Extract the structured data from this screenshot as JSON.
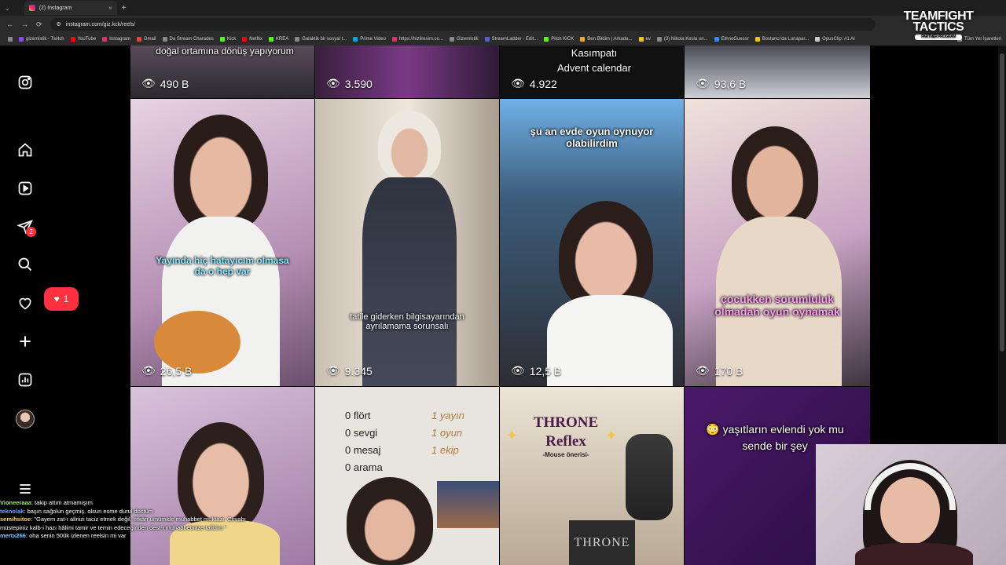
{
  "browser": {
    "tab_title": "(2) Instagram",
    "url": "instagram.com/giz.kck/reels/",
    "bookmarks": [
      "gizemistik - Twitch",
      "YouTube",
      "Instagram",
      "Gmail",
      "Da Stream Charades",
      "Kick",
      "Netflix",
      "KREA",
      "Galaktik bir sosyal t...",
      "Prime Video",
      "https://hizliresim.co...",
      "Gizemistik",
      "StreamLadder - Edit...",
      "Pitch KICK",
      "Ben Bildim | Arkada...",
      "ev",
      "(3) Nikola Kesla on...",
      "EthnoGuessr",
      "Bostancı'da Lunapar...",
      "OpusClip: #1 AI",
      "Tüm Yer İşaretleri"
    ]
  },
  "overlay": {
    "tft_line1": "TEAMFIGHT",
    "tft_line2": "TACTICS",
    "tft_badge": "PARTNER PROGRAM"
  },
  "sidebar": {
    "messages_badge": "2",
    "notifications_count": "1"
  },
  "reels": {
    "row0": [
      {
        "caption": "doğal ortamına dönüş yapıyorum",
        "views": "490 B"
      },
      {
        "caption": "",
        "views": "3.590"
      },
      {
        "caption": "Kasımpatı\nAdvent calendar",
        "views": "4.922"
      },
      {
        "caption": "",
        "views": "93,6 B"
      }
    ],
    "row1": [
      {
        "caption": "Yayında hiç hatayıcım olmasa da o hep var",
        "views": "26,5 B"
      },
      {
        "caption": "tatile giderken bilgisayarından ayrılamama sorunsalı",
        "views": "9.345"
      },
      {
        "caption": "şu an evde oyun oynuyor olabilirdim",
        "views": "12,5 B"
      },
      {
        "caption": "çocukken sorumluluk olmadan oyun oynamak",
        "views": "170 B"
      }
    ],
    "row2": [
      {
        "caption": ""
      },
      {
        "left_lines": [
          "0 flört",
          "0 sevgi",
          "0 mesaj",
          "0 arama"
        ],
        "right_lines": [
          "1 yayın",
          "1 oyun",
          "1 ekip"
        ]
      },
      {
        "title1": "THRONE",
        "title2": "Reflex",
        "subtitle": "-Mouse önerisi-",
        "brand": "THRONE"
      },
      {
        "caption": "😳 yaşıtların evlendi yok mu sende bir şey"
      }
    ]
  },
  "chat": [
    {
      "user": "Vioneeraaa",
      "text": ": takip attım atmamışım",
      "color": "#9fe870"
    },
    {
      "user": "teknolak",
      "text": ": başın sağolun geçmiş. olsun esme durul dostum",
      "color": "#6fa8ff"
    },
    {
      "user": "semihsitoe",
      "text": ": \"Gayem zat-ı alinizi taciz etmek değil, efkârı umumide muhabbet muktazi. Cevabı müstepiniz kalb-i hazı hâlimi tamir ve temin edeceğinden dest-i muhabbetinize talibim.\"",
      "color": "#ffd36b"
    },
    {
      "user": "mertx266",
      "text": ": oha senin 500k izlenen reelsin mi var",
      "color": "#7ecbff"
    }
  ]
}
